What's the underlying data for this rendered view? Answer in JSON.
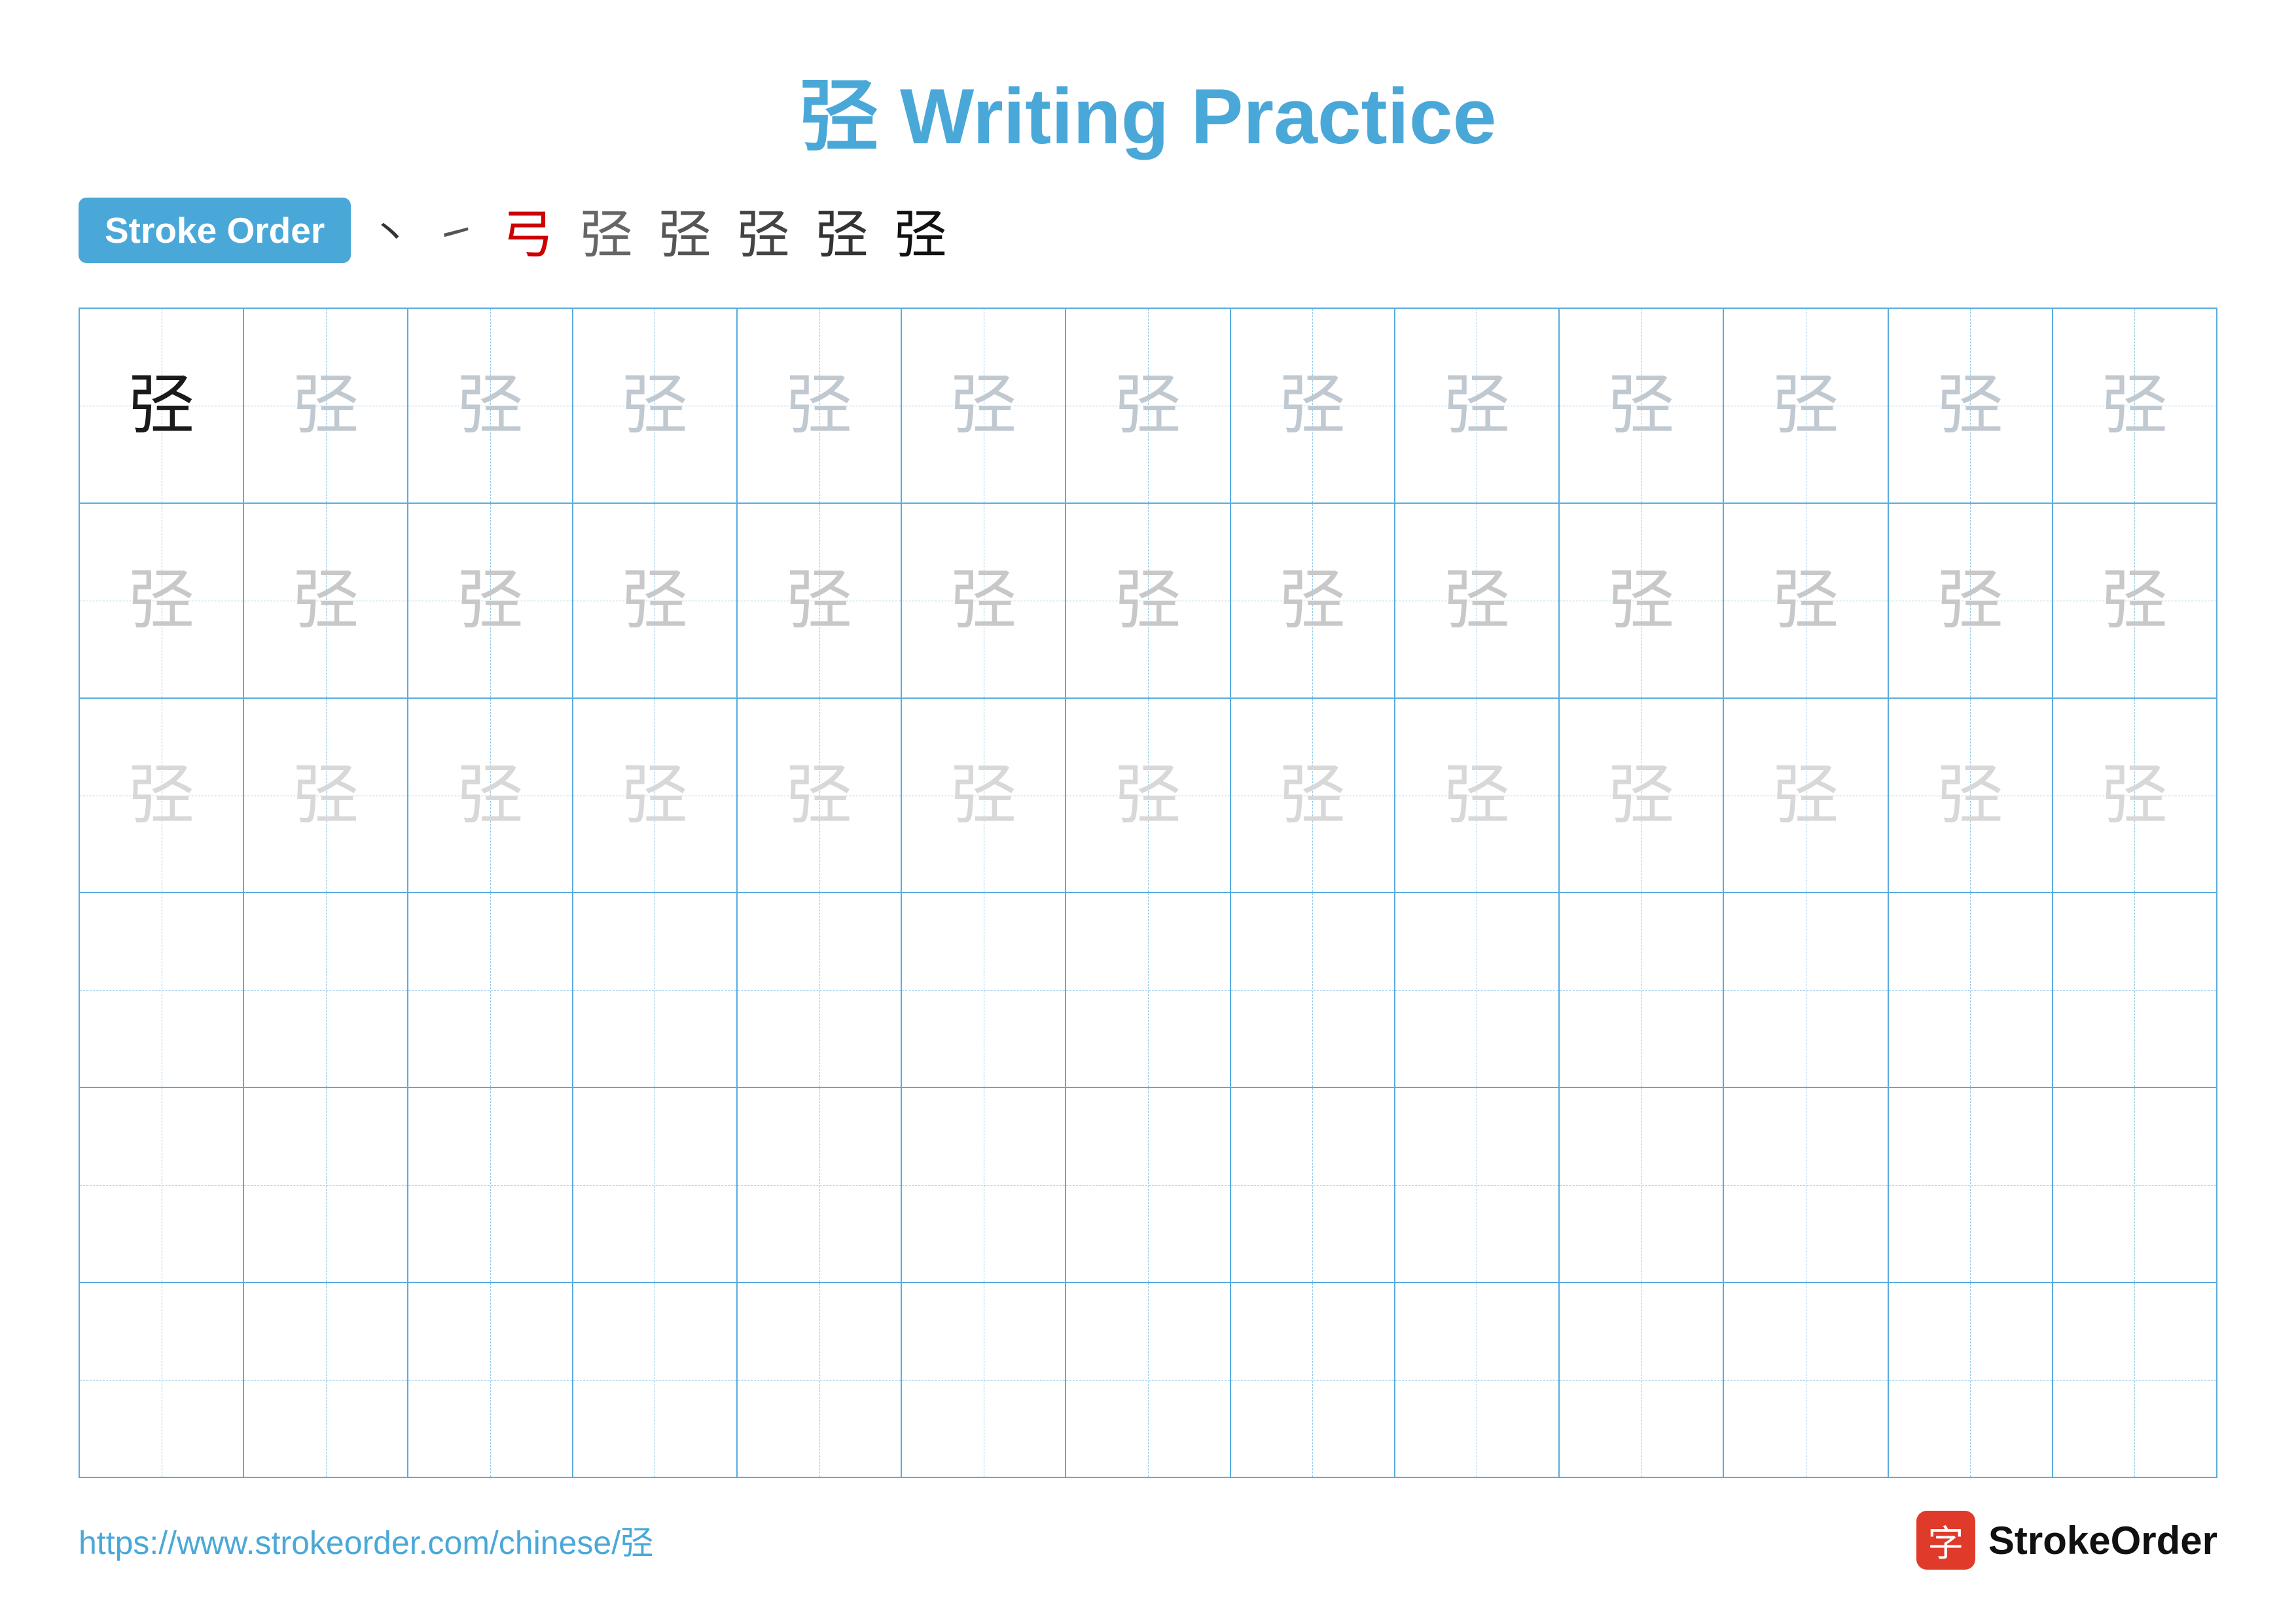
{
  "title": "弪 Writing Practice",
  "stroke_order": {
    "badge_label": "Stroke Order",
    "strokes": [
      {
        "char": "㇀",
        "style": "dark-small"
      },
      {
        "char": "㇀",
        "style": "dark-small"
      },
      {
        "char": "弓",
        "style": "red"
      },
      {
        "char": "弪",
        "style": "medium-dark"
      },
      {
        "char": "弪",
        "style": "medium-dark"
      },
      {
        "char": "弪",
        "style": "medium-dark"
      },
      {
        "char": "弪",
        "style": "medium-dark"
      },
      {
        "char": "弪",
        "style": "dark"
      }
    ]
  },
  "character": "弪",
  "rows": [
    {
      "type": "dark-then-gray",
      "dark_count": 1,
      "total": 13
    },
    {
      "type": "medium-gray",
      "total": 13
    },
    {
      "type": "light-gray",
      "total": 13
    },
    {
      "type": "empty",
      "total": 13
    },
    {
      "type": "empty",
      "total": 13
    },
    {
      "type": "empty",
      "total": 13
    }
  ],
  "footer": {
    "url": "https://www.strokeorder.com/chinese/弪",
    "logo_char": "字",
    "logo_text": "StrokeOrder"
  }
}
